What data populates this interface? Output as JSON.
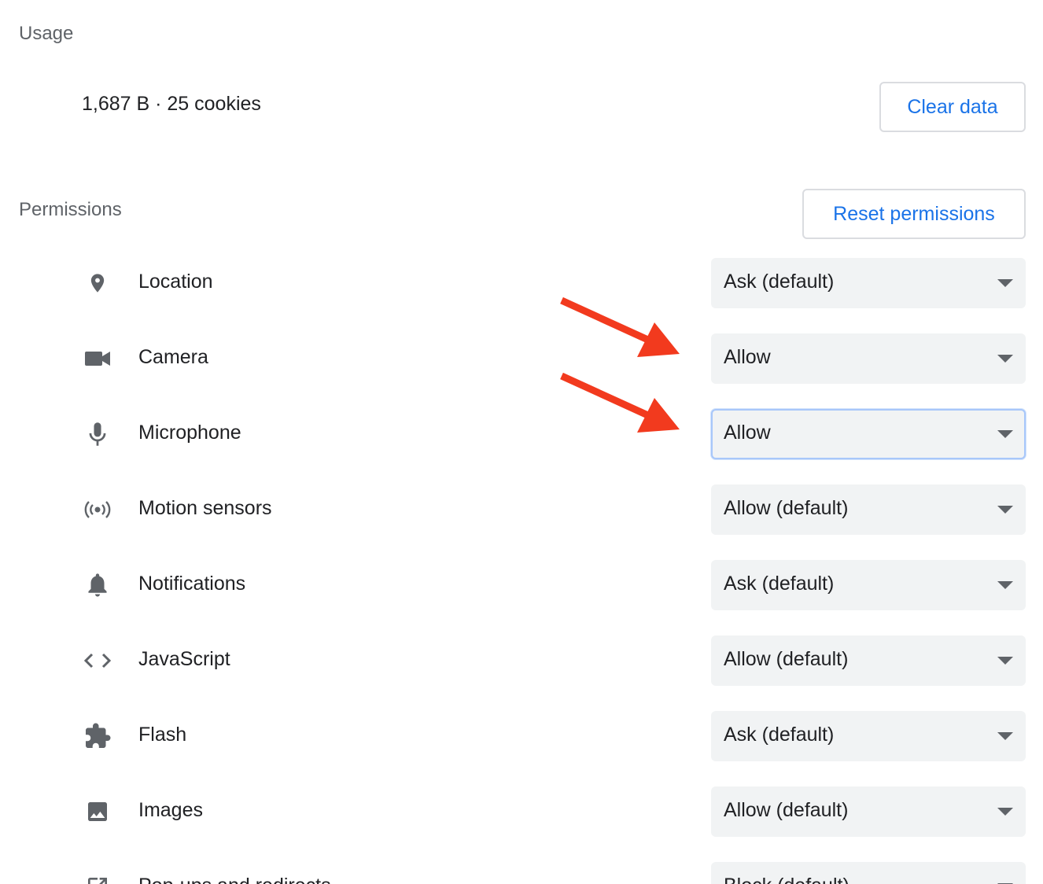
{
  "usage": {
    "title": "Usage",
    "summary": "1,687 B · 25 cookies",
    "clear_button": "Clear data"
  },
  "permissions": {
    "title": "Permissions",
    "reset_button": "Reset permissions",
    "items": [
      {
        "label": "Location",
        "icon": "location-pin-icon",
        "value": "Ask (default)"
      },
      {
        "label": "Camera",
        "icon": "camera-icon",
        "value": "Allow"
      },
      {
        "label": "Microphone",
        "icon": "microphone-icon",
        "value": "Allow"
      },
      {
        "label": "Motion sensors",
        "icon": "motion-sensors-icon",
        "value": "Allow (default)"
      },
      {
        "label": "Notifications",
        "icon": "bell-icon",
        "value": "Ask (default)"
      },
      {
        "label": "JavaScript",
        "icon": "code-icon",
        "value": "Allow (default)"
      },
      {
        "label": "Flash",
        "icon": "puzzle-piece-icon",
        "value": "Ask (default)"
      },
      {
        "label": "Images",
        "icon": "image-icon",
        "value": "Allow (default)"
      },
      {
        "label": "Pop-ups and redirects",
        "icon": "open-in-new-icon",
        "value": "Block (default)"
      }
    ]
  },
  "colors": {
    "accent": "#1a73e8",
    "annotation_arrow": "#f23a1e",
    "select_bg": "#f1f3f4",
    "icon": "#5f6368"
  }
}
